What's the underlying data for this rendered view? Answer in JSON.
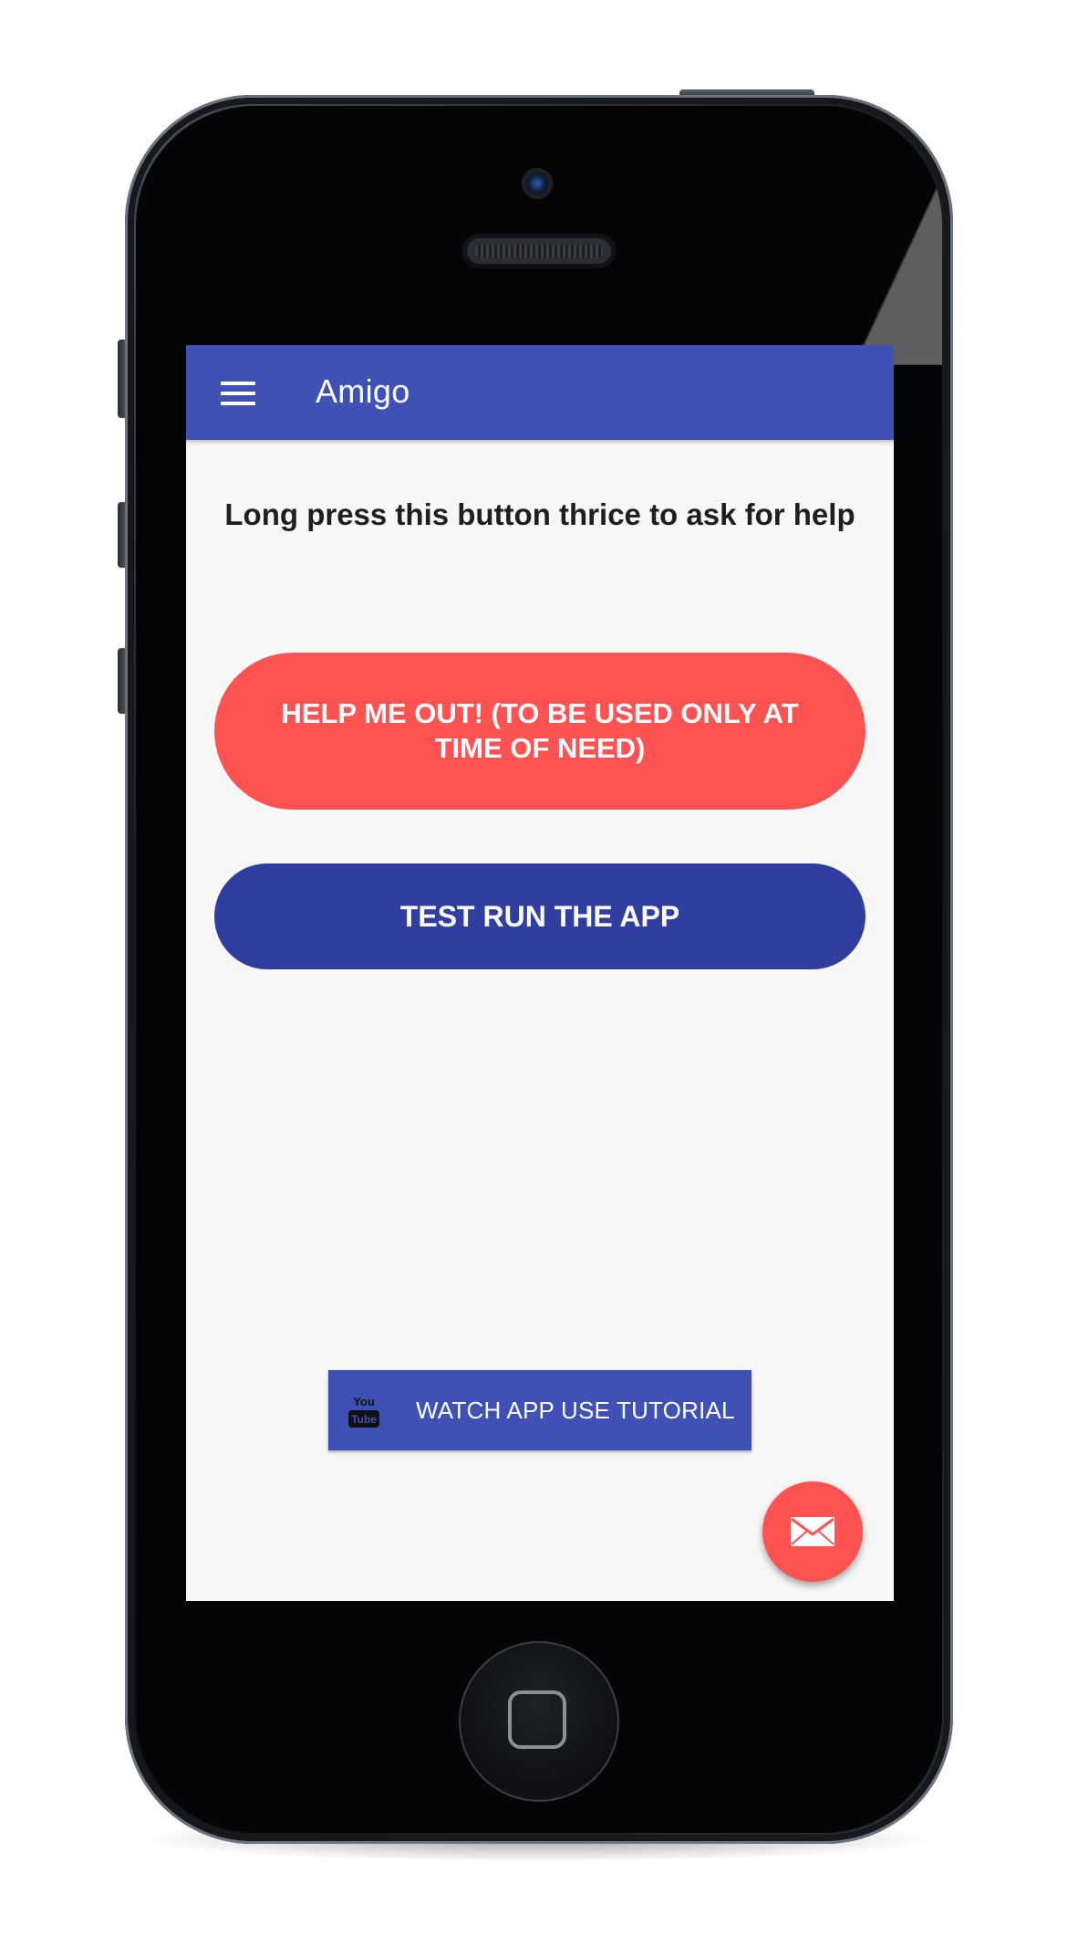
{
  "app_bar": {
    "title": "Amigo",
    "menu_icon": "hamburger-menu-icon"
  },
  "main": {
    "instruction": "Long press this button thrice to ask for help",
    "help_button_label": "HELP ME OUT! (TO BE USED ONLY AT TIME OF NEED)",
    "test_button_label": "TEST RUN THE APP",
    "tutorial_button": {
      "label": "WATCH APP USE TUTORIAL",
      "icon": "youtube-icon"
    }
  },
  "fab": {
    "icon": "mail-icon"
  },
  "colors": {
    "app_bar": "#3f51b5",
    "help_button": "#ff5252",
    "test_button": "#303f9f",
    "background": "#f7f7f8",
    "fab": "#ff5252"
  }
}
